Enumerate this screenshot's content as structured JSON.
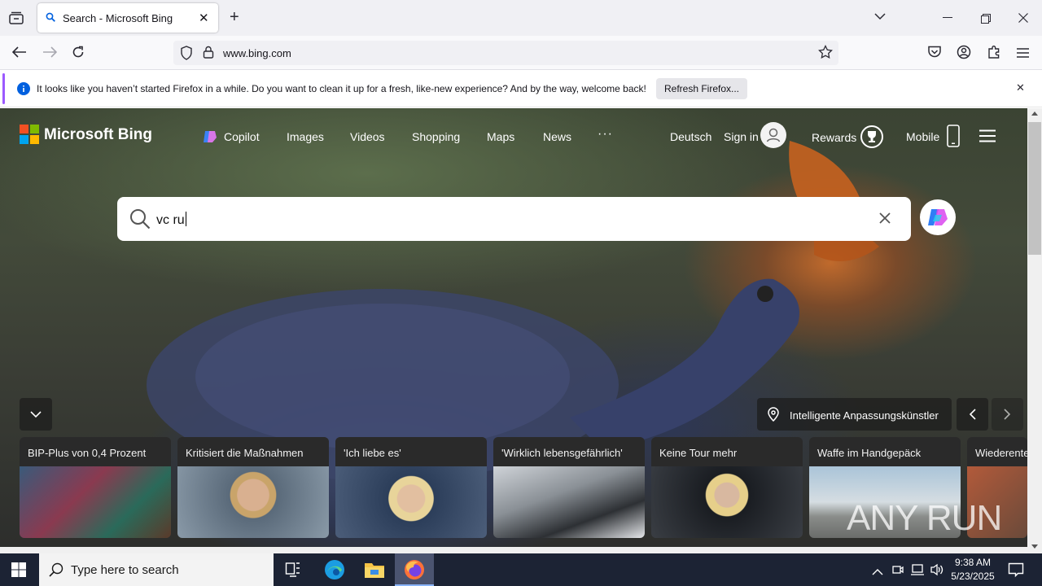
{
  "browser": {
    "tab": {
      "title": "Search - Microsoft Bing"
    },
    "url": "www.bing.com",
    "notification": {
      "message": "It looks like you haven’t started Firefox in a while. Do you want to clean it up for a fresh, like-new experience? And by the way, welcome back!",
      "button": "Refresh Firefox..."
    }
  },
  "bing": {
    "logo": "Microsoft Bing",
    "nav": [
      "Copilot",
      "Images",
      "Videos",
      "Shopping",
      "Maps",
      "News"
    ],
    "more": "···",
    "language": "Deutsch",
    "sign_in": "Sign in",
    "rewards": "Rewards",
    "mobile": "Mobile",
    "search_value": "vc ru",
    "location_label": "Intelligente Anpassungskünstler",
    "news_cards": [
      {
        "caption": "BIP-Plus von 0,4 Prozent"
      },
      {
        "caption": "Kritisiert die Maßnahmen"
      },
      {
        "caption": "'Ich liebe es'"
      },
      {
        "caption": "'Wirklich lebensgefährlich'"
      },
      {
        "caption": "Keine Tour mehr"
      },
      {
        "caption": "Waffe im Handgepäck"
      },
      {
        "caption": "Wiederente"
      }
    ],
    "watermark": "ANY RUN"
  },
  "taskbar": {
    "search_placeholder": "Type here to search",
    "time": "9:38 AM",
    "date": "5/23/2025"
  },
  "colors": {
    "accent": "#9b59ff",
    "taskbar": "#1c2334",
    "firefox_active": "#4b5470"
  }
}
